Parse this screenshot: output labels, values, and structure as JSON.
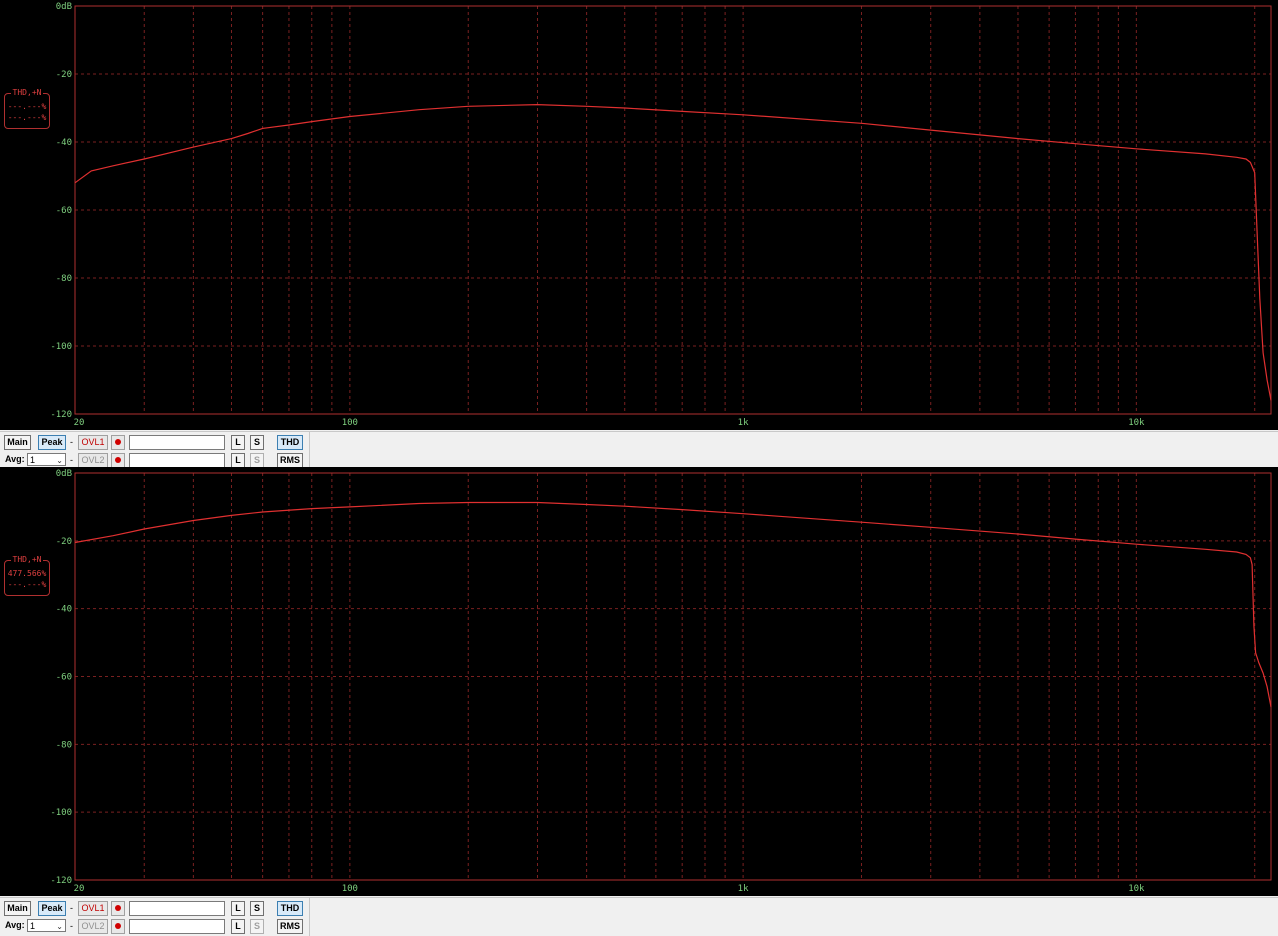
{
  "colors": {
    "trace": "#e03030",
    "grid": "#7a2020",
    "frame": "#b03030",
    "axis_text": "#7fd07f"
  },
  "panels": [
    {
      "readout": {
        "label": "THD,+N",
        "line1": "---.---%",
        "line2": "---.---%"
      },
      "toolbar": {
        "main": "Main",
        "peak": "Peak",
        "dash1": "-",
        "ovl1": "OVL1",
        "avg_label": "Avg:",
        "avg_value": "1",
        "dash2": "-",
        "ovl2": "OVL2",
        "l": "L",
        "s": "S",
        "thd": "THD",
        "rms": "RMS"
      },
      "chart_data": {
        "type": "line",
        "x_scale": "log",
        "xlim": [
          20,
          22000
        ],
        "ylim": [
          -120,
          0
        ],
        "x_ticks": [
          "20",
          "100",
          "1k",
          "10k"
        ],
        "y_ticks": [
          "0dB",
          "-20",
          "-40",
          "-60",
          "-80",
          "-100",
          "-120"
        ],
        "grid": true,
        "series": [
          {
            "x": [
              20,
              22,
              25,
              30,
              40,
              50,
              55,
              60,
              70,
              80,
              100,
              150,
              200,
              300,
              400,
              500,
              700,
              1000,
              2000,
              3000,
              5000,
              7000,
              10000,
              15000,
              18000,
              19000,
              19500,
              20000,
              20300,
              20600,
              21000,
              21500,
              22000
            ],
            "y": [
              -52,
              -48.5,
              -47,
              -45,
              -41.5,
              -39,
              -37.5,
              -36,
              -35,
              -34,
              -32.5,
              -30.5,
              -29.5,
              -29,
              -29.5,
              -30,
              -31,
              -32,
              -34.5,
              -36.5,
              -39,
              -40.5,
              -42,
              -43.5,
              -44.5,
              -45,
              -46,
              -49,
              -68,
              -86,
              -102,
              -110,
              -116
            ]
          }
        ]
      }
    },
    {
      "readout": {
        "label": "THD,+N",
        "line1": "477.566%",
        "line2": "---.---%"
      },
      "toolbar": {
        "main": "Main",
        "peak": "Peak",
        "dash1": "-",
        "ovl1": "OVL1",
        "avg_label": "Avg:",
        "avg_value": "1",
        "dash2": "-",
        "ovl2": "OVL2",
        "l": "L",
        "s": "S",
        "thd": "THD",
        "rms": "RMS"
      },
      "chart_data": {
        "type": "line",
        "x_scale": "log",
        "xlim": [
          20,
          22000
        ],
        "ylim": [
          -120,
          0
        ],
        "x_ticks": [
          "20",
          "100",
          "1k",
          "10k"
        ],
        "y_ticks": [
          "0dB",
          "-20",
          "-40",
          "-60",
          "-80",
          "-100",
          "-120"
        ],
        "grid": true,
        "series": [
          {
            "x": [
              20,
              25,
              30,
              40,
              50,
              60,
              80,
              100,
              150,
              200,
              300,
              400,
              500,
              700,
              1000,
              2000,
              3000,
              5000,
              7000,
              10000,
              15000,
              18000,
              19000,
              19500,
              19700,
              19900,
              20100,
              20500,
              21000,
              21500,
              22000
            ],
            "y": [
              -20.5,
              -18.5,
              -16.5,
              -14,
              -12.5,
              -11.5,
              -10.5,
              -10,
              -9,
              -8.7,
              -8.7,
              -9.3,
              -9.8,
              -10.8,
              -12,
              -14.5,
              -16,
              -18,
              -19.5,
              -21,
              -22.5,
              -23.3,
              -24,
              -25,
              -27,
              -45,
              -53,
              -56,
              -59,
              -63,
              -69
            ]
          }
        ]
      }
    }
  ]
}
